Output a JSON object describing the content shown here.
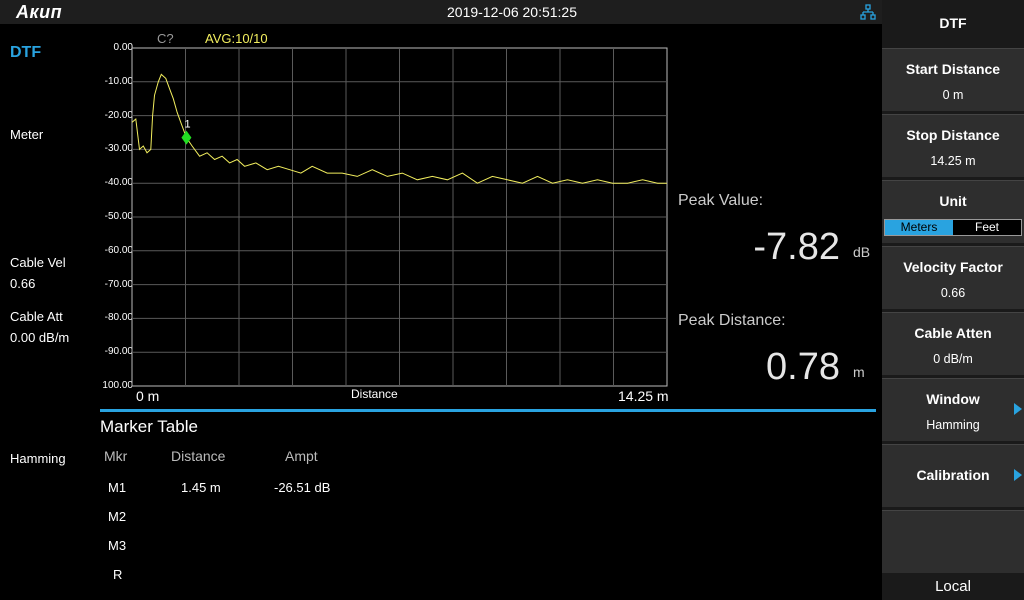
{
  "topbar": {
    "logo": "Акип",
    "datetime": "2019-12-06 20:51:25",
    "network_icon": "network-icon"
  },
  "left_panel": {
    "mode": "DTF",
    "meter_label": "Meter",
    "cable_vel_label": "Cable Vel",
    "cable_vel_value": "0.66",
    "cable_att_label": "Cable Att",
    "cable_att_value": "0.00 dB/m",
    "window_label": "Hamming"
  },
  "plot": {
    "c_label": "C?",
    "avg_label": "AVG:10/10",
    "x_start": "0 m",
    "x_label": "Distance",
    "x_stop": "14.25 m",
    "marker_label": "1",
    "colors": {
      "trace": "#f2ee5e",
      "marker": "#22dd22",
      "grid": "#5a5a5a"
    }
  },
  "chart_data": {
    "type": "line",
    "xlabel": "Distance",
    "ylabel": "",
    "xlim": [
      0,
      14.25
    ],
    "ylim": [
      -100,
      0
    ],
    "y_tick_labels": [
      "0.00",
      "-10.00",
      "-20.00",
      "-30.00",
      "-40.00",
      "-50.00",
      "-60.00",
      "-70.00",
      "-80.00",
      "-90.00",
      "100.00"
    ],
    "grid": true,
    "series": [
      {
        "values_x": [
          0,
          0.1,
          0.2,
          0.3,
          0.4,
          0.5,
          0.55,
          0.6,
          0.7,
          0.78,
          0.9,
          1.0,
          1.1,
          1.2,
          1.3,
          1.45,
          1.6,
          1.8,
          2.0,
          2.2,
          2.4,
          2.6,
          2.8,
          3.0,
          3.3,
          3.6,
          3.9,
          4.2,
          4.5,
          4.8,
          5.2,
          5.6,
          6.0,
          6.4,
          6.8,
          7.2,
          7.6,
          8.0,
          8.4,
          8.8,
          9.2,
          9.6,
          10.0,
          10.4,
          10.8,
          11.2,
          11.6,
          12.0,
          12.4,
          12.8,
          13.2,
          13.6,
          14.0,
          14.25
        ],
        "values_y": [
          -22,
          -21,
          -30,
          -29,
          -31,
          -30,
          -20,
          -14,
          -10,
          -7.82,
          -9,
          -12,
          -15,
          -19,
          -22,
          -26.51,
          -29,
          -32,
          -31,
          -33,
          -32,
          -34,
          -33,
          -35,
          -34,
          -36,
          -35,
          -36,
          -37,
          -35,
          -37,
          -37,
          -38,
          -36,
          -38,
          -37,
          -39,
          -38,
          -39,
          -37,
          -40,
          -38,
          -39,
          -40,
          -38,
          -40,
          -39,
          -40,
          -39,
          -40,
          -40,
          -39,
          -40,
          -40
        ]
      }
    ],
    "markers": [
      {
        "name": "1",
        "x": 1.45,
        "y": -26.51
      }
    ]
  },
  "readouts": {
    "peak_value_label": "Peak Value:",
    "peak_value": "-7.82",
    "peak_value_unit": "dB",
    "peak_distance_label": "Peak Distance:",
    "peak_distance": "0.78",
    "peak_distance_unit": "m"
  },
  "marker_table": {
    "title": "Marker Table",
    "headers": [
      "Mkr",
      "Distance",
      "Ampt"
    ],
    "rows": [
      [
        "M1",
        "1.45 m",
        "-26.51 dB"
      ],
      [
        "M2",
        "",
        ""
      ],
      [
        "M3",
        "",
        ""
      ],
      [
        "R",
        "",
        ""
      ]
    ]
  },
  "softkeys": {
    "header": "DTF",
    "start_distance": {
      "label": "Start Distance",
      "value": "0 m"
    },
    "stop_distance": {
      "label": "Stop Distance",
      "value": "14.25 m"
    },
    "unit": {
      "label": "Unit",
      "options": [
        "Meters",
        "Feet"
      ],
      "selected": "Meters"
    },
    "velocity_factor": {
      "label": "Velocity Factor",
      "value": "0.66"
    },
    "cable_atten": {
      "label": "Cable Atten",
      "value": "0 dB/m"
    },
    "window": {
      "label": "Window",
      "value": "Hamming"
    },
    "calibration": {
      "label": "Calibration"
    },
    "local": "Local",
    "accent": "#29a3e0"
  }
}
